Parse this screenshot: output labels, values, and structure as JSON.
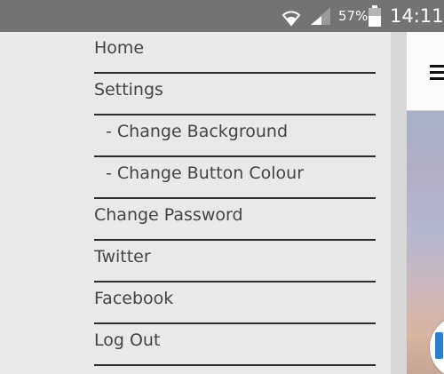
{
  "status_bar": {
    "battery_percent": "57%",
    "time": "14:11",
    "icons": [
      "wifi-icon",
      "signal-icon",
      "battery-icon"
    ]
  },
  "menu": {
    "items": [
      {
        "label": "Home"
      },
      {
        "label": "Settings"
      },
      {
        "label": "- Change Background"
      },
      {
        "label": "- Change Button Colour"
      },
      {
        "label": "Change Password"
      },
      {
        "label": "Twitter"
      },
      {
        "label": "Facebook"
      },
      {
        "label": "Log Out"
      }
    ]
  },
  "colors": {
    "status_bar_bg": "#737373",
    "menu_bg": "#e9e9e9",
    "menu_text": "#444444",
    "menu_divider": "#2d2d2d",
    "fab_accent": "#2b7fcf"
  },
  "icons": {
    "menu_toggle": "hamburger-icon"
  }
}
